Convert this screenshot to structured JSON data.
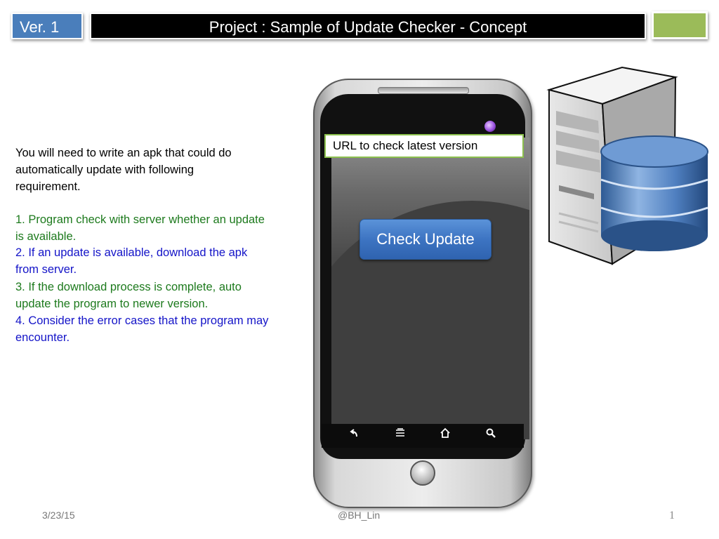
{
  "header": {
    "version": "Ver. 1",
    "title": "Project :  Sample of Update Checker - Concept"
  },
  "description": {
    "line1": "You will need to write an apk that could do",
    "line2": "automatically update with following",
    "line3": "requirement."
  },
  "requirements": [
    {
      "line1": "1. Program check with server whether an update",
      "line2": "is available.",
      "color": "#1d7a1d"
    },
    {
      "line1": "2. If an update is available, download the apk",
      "line2": "from server.",
      "color": "#1414c8"
    },
    {
      "line1": "3. If the download process is complete, auto",
      "line2": "update the program to newer version.",
      "color": "#1d7a1d"
    },
    {
      "line1": "4. Consider the error cases that the program may",
      "line2": "encounter.",
      "color": "#1414c8"
    }
  ],
  "phone": {
    "url_field": "URL to check latest version",
    "check_button": "Check Update",
    "nav_icons": [
      "back-icon",
      "menu-icon",
      "home-icon",
      "search-icon"
    ]
  },
  "footer": {
    "date": "3/23/15",
    "author": "@BH_Lin",
    "page": "1"
  },
  "colors": {
    "version_box": "#4a7ebb",
    "title_bar": "#000000",
    "accent_box": "#9bbb59",
    "button": "#3d74c2"
  }
}
